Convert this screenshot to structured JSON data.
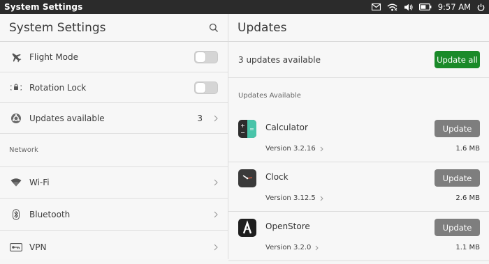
{
  "statusbar": {
    "title": "System Settings",
    "time": "9:57 AM",
    "icons": [
      "mail-icon",
      "wifi-icon",
      "volume-icon",
      "battery-icon",
      "power-icon"
    ]
  },
  "left": {
    "title": "System Settings",
    "items": [
      {
        "label": "Flight Mode",
        "icon": "airplane-icon",
        "control": "toggle",
        "on": false
      },
      {
        "label": "Rotation Lock",
        "icon": "rotation-lock-icon",
        "control": "toggle",
        "on": false
      },
      {
        "label": "Updates available",
        "icon": "updates-icon",
        "value": "3",
        "control": "chevron"
      }
    ],
    "section": "Network",
    "network_items": [
      {
        "label": "Wi-Fi",
        "icon": "wifi-icon"
      },
      {
        "label": "Bluetooth",
        "icon": "bluetooth-icon"
      },
      {
        "label": "VPN",
        "icon": "vpn-icon"
      }
    ]
  },
  "right": {
    "title": "Updates",
    "summary": "3 updates available",
    "update_all_label": "Update all",
    "update_all_color": "#1a8a29",
    "section": "Updates Available",
    "apps": [
      {
        "name": "Calculator",
        "version": "Version 3.2.16",
        "size": "1.6 MB",
        "button": "Update",
        "icon": "calculator-icon"
      },
      {
        "name": "Clock",
        "version": "Version 3.12.5",
        "size": "2.6 MB",
        "button": "Update",
        "icon": "clock-icon"
      },
      {
        "name": "OpenStore",
        "version": "Version 3.2.0",
        "size": "1.1 MB",
        "button": "Update",
        "icon": "openstore-icon"
      }
    ]
  }
}
